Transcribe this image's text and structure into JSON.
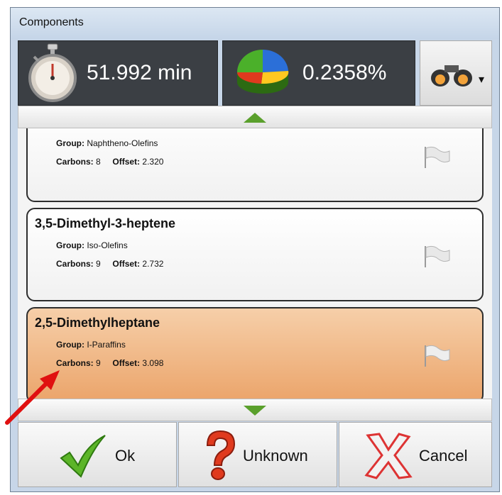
{
  "window": {
    "title": "Components"
  },
  "toolbar": {
    "retention_time": "51.992 min",
    "percentage": "0.2358%",
    "find_icon": "binoculars-icon",
    "time_icon": "stopwatch-icon",
    "percent_icon": "pie-chart-icon"
  },
  "components": [
    {
      "name": "",
      "group_label": "Group:",
      "group": "Naphtheno-Olefins",
      "carbons_label": "Carbons:",
      "carbons": "8",
      "offset_label": "Offset:",
      "offset": "2.320",
      "selected": false
    },
    {
      "name": "3,5-Dimethyl-3-heptene",
      "group_label": "Group:",
      "group": "Iso-Olefins",
      "carbons_label": "Carbons:",
      "carbons": "9",
      "offset_label": "Offset:",
      "offset": "2.732",
      "selected": false
    },
    {
      "name": "2,5-Dimethylheptane",
      "group_label": "Group:",
      "group": "I-Paraffins",
      "carbons_label": "Carbons:",
      "carbons": "9",
      "offset_label": "Offset:",
      "offset": "3.098",
      "selected": true
    }
  ],
  "buttons": {
    "ok": "Ok",
    "unknown": "Unknown",
    "cancel": "Cancel"
  },
  "colors": {
    "selected_card": "#eba46a",
    "tile_dark": "#3b3f44",
    "scroll_arrow": "#5aa02c",
    "annotation_arrow": "#e01010"
  }
}
